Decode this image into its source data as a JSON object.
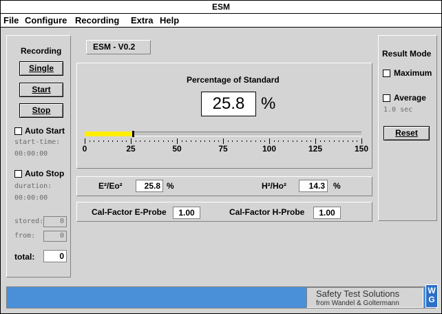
{
  "window": {
    "title": "ESM"
  },
  "menu": [
    "File",
    "Configure",
    "Recording",
    "Extra",
    "Help"
  ],
  "recording": {
    "title": "Recording",
    "single": "Single",
    "start": "Start",
    "stop": "Stop",
    "auto_start": "Auto Start",
    "start_time_label": "start-time:",
    "start_time_value": "00:00:00",
    "auto_stop": "Auto Stop",
    "duration_label": "duration:",
    "duration_value": "00:00:00",
    "stored_label": "stored:",
    "stored_value": "0",
    "from_label": "from:",
    "from_value": "0",
    "total_label": "total:",
    "total_value": "0"
  },
  "version_label": "ESM  -  V0.2",
  "measurement": {
    "title": "Percentage of Standard",
    "value": "25.8",
    "unit": "%",
    "bar_fraction": 0.172,
    "scale_min": 0,
    "scale_max": 150,
    "ticks": [
      "0",
      "25",
      "50",
      "75",
      "100",
      "125",
      "150"
    ]
  },
  "ratios": {
    "e_label": "E²/Eo²",
    "e_value": "25.8",
    "e_unit": "%",
    "h_label": "H²/Ho²",
    "h_value": "14.3",
    "h_unit": "%"
  },
  "cal": {
    "e_label": "Cal-Factor E-Probe",
    "e_value": "1.00",
    "h_label": "Cal-Factor H-Probe",
    "h_value": "1.00"
  },
  "result_mode": {
    "title": "Result Mode",
    "maximum": "Maximum",
    "average": "Average",
    "average_time": "1.0 sec",
    "reset": "Reset"
  },
  "branding": {
    "company": "Safety Test Solutions",
    "subtitle": "from Wandel & Goltermann",
    "logo_text": "WG"
  },
  "colors": {
    "bar_fill": "#ffee00",
    "status_bar": "#4a90d9"
  }
}
